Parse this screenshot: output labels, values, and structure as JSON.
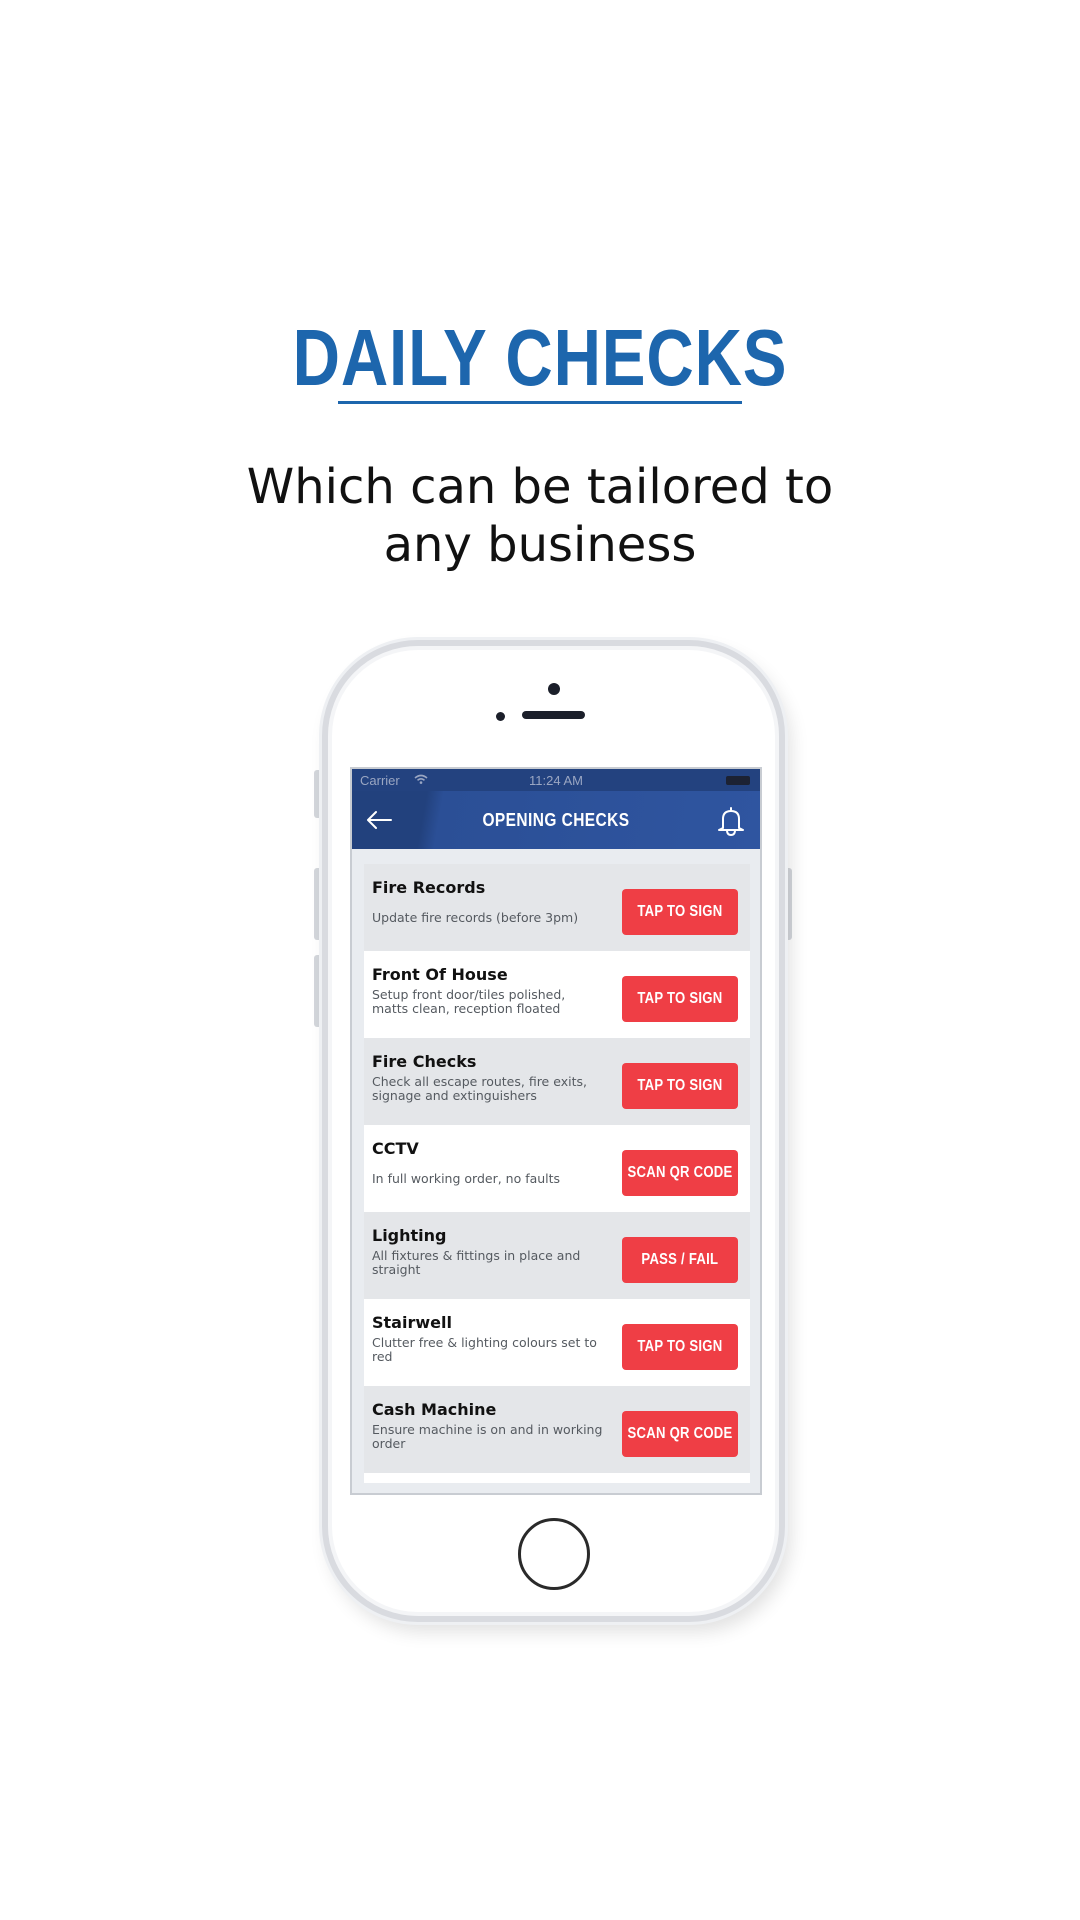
{
  "promo": {
    "title": "DAILY CHECKS",
    "subtitle_line1": "Which can be tailored to",
    "subtitle_line2": "any business"
  },
  "status_bar": {
    "carrier": "Carrier",
    "time": "11:24 AM"
  },
  "nav": {
    "title": "OPENING CHECKS"
  },
  "checks": [
    {
      "title": "Fire Records",
      "description": "Update fire records (before 3pm)",
      "action": "TAP TO SIGN"
    },
    {
      "title": "Front Of House",
      "description": "Setup front door/tiles polished, matts clean, reception floated",
      "action": "TAP TO SIGN"
    },
    {
      "title": "Fire Checks",
      "description": "Check all escape routes, fire exits, signage and extinguishers",
      "action": "TAP TO SIGN"
    },
    {
      "title": "CCTV",
      "description": "In full working order, no faults",
      "action": "SCAN QR CODE"
    },
    {
      "title": "Lighting",
      "description": "All fixtures & fittings in place and straight",
      "action": "PASS / FAIL"
    },
    {
      "title": "Stairwell",
      "description": "Clutter free & lighting colours set to red",
      "action": "TAP TO SIGN"
    },
    {
      "title": "Cash Machine",
      "description": "Ensure machine is on and in working order",
      "action": "SCAN QR CODE"
    }
  ],
  "colors": {
    "promo_blue": "#1d66ad",
    "nav_blue": "#2f55a0",
    "action_red": "#ef3e45"
  }
}
